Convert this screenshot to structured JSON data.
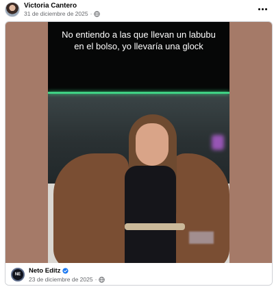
{
  "post": {
    "author": "Victoria Cantero",
    "date": "31 de diciembre de 2025",
    "separator": "·",
    "privacy_icon": "globe-icon",
    "more_icon": "more-horizontal-icon"
  },
  "shared": {
    "caption": "No entiendo a las que llevan un labubu en el bolso, yo llevaría una glock",
    "source_name": "Neto Editz",
    "source_avatar_text": "NE",
    "source_date": "23 de diciembre de 2025",
    "separator": "·",
    "verified_icon": "verified-badge-icon",
    "privacy_icon": "globe-icon"
  },
  "colors": {
    "media_background": "#a57a68",
    "verified_badge": "#1877f2",
    "secondary_text": "#65676b"
  }
}
